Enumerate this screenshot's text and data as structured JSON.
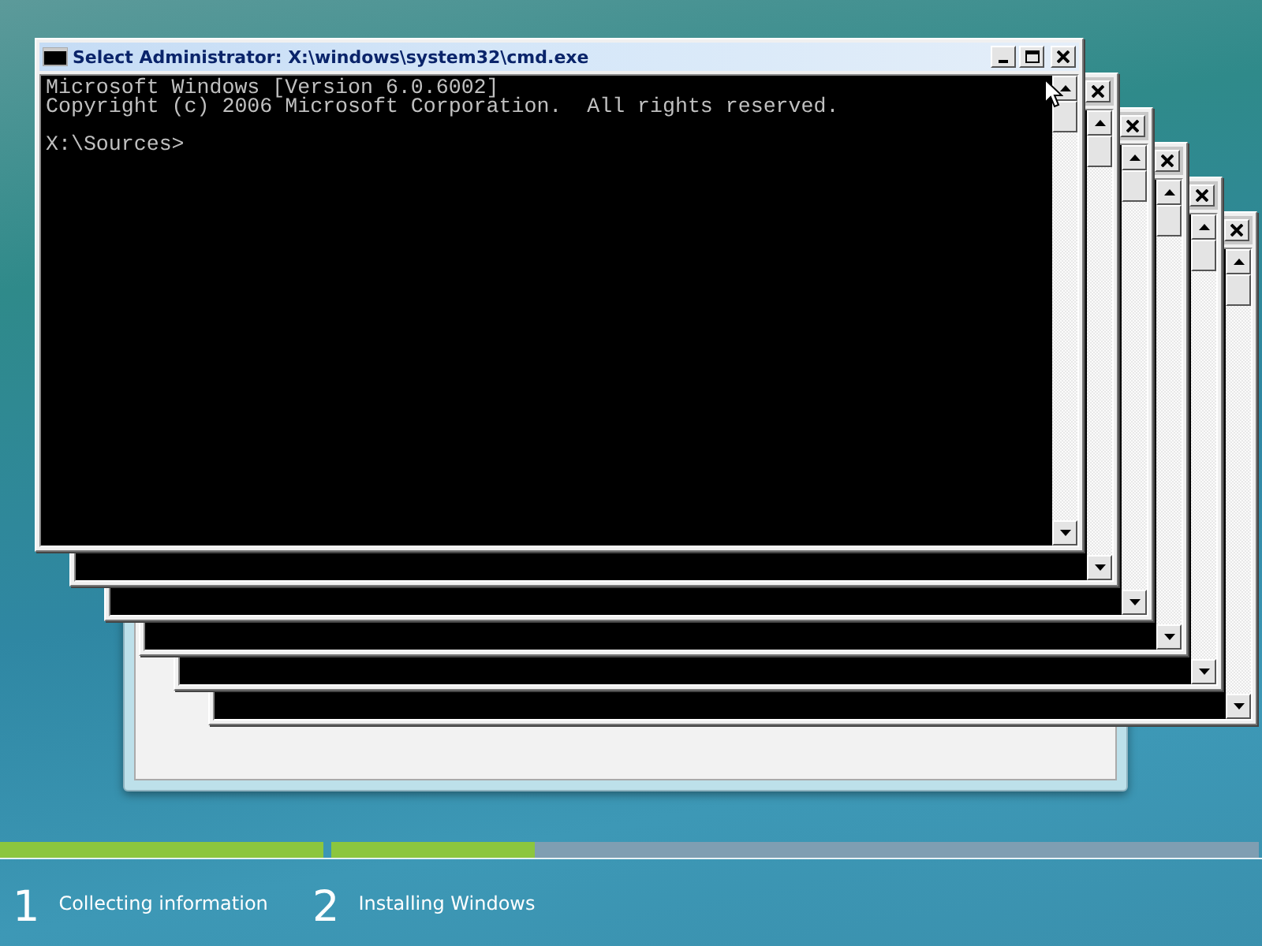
{
  "stacked_windows": [
    {
      "kind": "console"
    },
    {
      "kind": "console"
    },
    {
      "kind": "console"
    },
    {
      "kind": "console"
    },
    {
      "kind": "console"
    }
  ],
  "console_window": {
    "title": "Select Administrator: X:\\windows\\system32\\cmd.exe",
    "lines": [
      "Microsoft Windows [Version 6.0.6002]",
      "Copyright (c) 2006 Microsoft Corporation.  All rights reserved."
    ],
    "prompt": "X:\\Sources>"
  },
  "steps": [
    {
      "number": "1",
      "label": "Collecting information",
      "level": 1
    },
    {
      "number": "2",
      "label": "Installing Windows",
      "level": 0.22
    }
  ]
}
